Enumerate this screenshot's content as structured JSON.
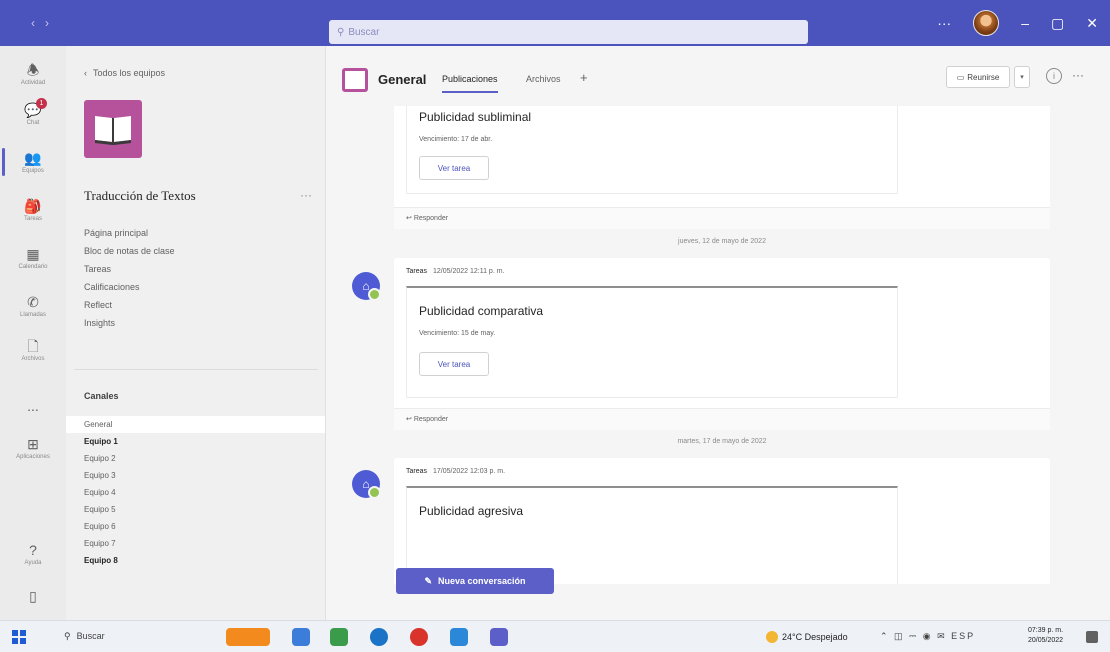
{
  "titlebar": {
    "search_placeholder": "Buscar",
    "nav_icons": [
      "back-arrow-icon",
      "forward-arrow-icon"
    ]
  },
  "appbar": {
    "items": [
      {
        "label": "Actividad",
        "icon": "bell-icon"
      },
      {
        "label": "Chat",
        "icon": "chat-icon",
        "badge": "1"
      },
      {
        "label": "Equipos",
        "icon": "teams-icon"
      },
      {
        "label": "Tareas",
        "icon": "tasks-icon"
      },
      {
        "label": "Calendario",
        "icon": "calendar-icon"
      },
      {
        "label": "Llamadas",
        "icon": "phone-icon"
      },
      {
        "label": "Archivos",
        "icon": "file-icon"
      },
      {
        "label": "...",
        "icon": "more-icon"
      },
      {
        "label": "Aplicaciones",
        "icon": "apps-icon"
      },
      {
        "label": "Ayuda",
        "icon": "help-icon"
      },
      {
        "label": "",
        "icon": "device-icon"
      }
    ]
  },
  "team": {
    "back_label": "Todos los equipos",
    "name": "Traducción de Textos",
    "menu": [
      "Página principal",
      "Bloc de notas de clase",
      "Tareas",
      "Calificaciones",
      "Reflect",
      "Insights"
    ],
    "channels_heading": "Canales",
    "channels": [
      {
        "name": "General",
        "selected": true,
        "bold": false
      },
      {
        "name": "Equipo 1",
        "selected": false,
        "bold": true
      },
      {
        "name": "Equipo 2",
        "selected": false,
        "bold": false
      },
      {
        "name": "Equipo 3",
        "selected": false,
        "bold": false
      },
      {
        "name": "Equipo 4",
        "selected": false,
        "bold": false
      },
      {
        "name": "Equipo 5",
        "selected": false,
        "bold": false
      },
      {
        "name": "Equipo 6",
        "selected": false,
        "bold": false
      },
      {
        "name": "Equipo 7",
        "selected": false,
        "bold": false
      },
      {
        "name": "Equipo 8",
        "selected": false,
        "bold": true
      }
    ]
  },
  "channel": {
    "title": "General",
    "tabs": [
      "Publicaciones",
      "Archivos"
    ],
    "active_tab": "Publicaciones",
    "add_tab": "+",
    "meet_label": "Reunirse"
  },
  "feed": {
    "posts": [
      {
        "title": "Publicidad subliminal",
        "due": "Vencimiento: 17 de abr.",
        "button": "Ver tarea",
        "reply": "Responder"
      },
      {
        "date": "jueves, 12 de mayo de 2022",
        "author": "Tareas",
        "time": "12/05/2022 12:11 p. m.",
        "title": "Publicidad comparativa",
        "due": "Vencimiento: 15 de may.",
        "button": "Ver tarea",
        "reply": "Responder"
      },
      {
        "date": "martes, 17 de mayo de 2022",
        "author": "Tareas",
        "time": "17/05/2022 12:03 p. m.",
        "title": "Publicidad agresiva"
      }
    ],
    "new_conversation": "Nueva conversación"
  },
  "taskbar": {
    "search_label": "Buscar",
    "weather": "24°C Despejado",
    "time": "07:39 p. m.",
    "date": "20/05/2022",
    "app_colors": [
      "#f28a1e",
      "#3b7dd8",
      "#3a9b4b",
      "#1a73c7",
      "#d9342b",
      "#2b88d8",
      "#5b5fc7"
    ]
  },
  "colors": {
    "brand": "#4b53bc",
    "team_logo": "#b6529c",
    "accent": "#5b5fc7"
  }
}
